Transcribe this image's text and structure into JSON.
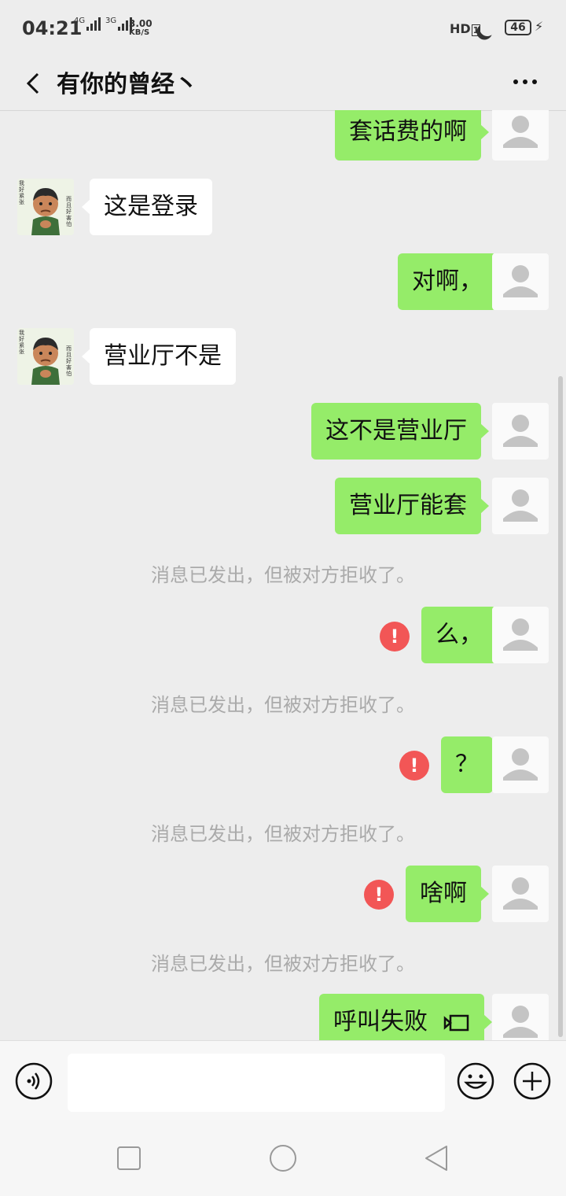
{
  "status_bar": {
    "time": "04:21",
    "net1": "4G",
    "net2": "3G",
    "speed_value": "3.00",
    "speed_unit": "KB/S",
    "hd_label": "HD",
    "hd_sub": "1",
    "battery": "46"
  },
  "header": {
    "title": "有你的曾经丶",
    "back_icon": "chevron-left-icon",
    "more_icon": "more-dots-icon"
  },
  "messages": [
    {
      "side": "out",
      "text": "套话费的啊"
    },
    {
      "side": "in",
      "text": "这是登录"
    },
    {
      "side": "out",
      "text": "对啊，"
    },
    {
      "side": "in",
      "text": "营业厅不是"
    },
    {
      "side": "out",
      "text": "这不是营业厅"
    },
    {
      "side": "out",
      "text": "营业厅能套"
    },
    {
      "side": "system",
      "text": "消息已发出，但被对方拒收了。"
    },
    {
      "side": "out",
      "text": "么，",
      "failed": true,
      "fail_mark": "!"
    },
    {
      "side": "system",
      "text": "消息已发出，但被对方拒收了。"
    },
    {
      "side": "out",
      "text": "？",
      "failed": true,
      "fail_mark": "!"
    },
    {
      "side": "system",
      "text": "消息已发出，但被对方拒收了。"
    },
    {
      "side": "out",
      "text": "啥啊",
      "failed": true,
      "fail_mark": "!"
    },
    {
      "side": "system",
      "text": "消息已发出，但被对方拒收了。"
    },
    {
      "side": "out",
      "text": "呼叫失败",
      "icon": "video-call-icon"
    }
  ],
  "peer_avatar_caption_left": "我好紧张",
  "peer_avatar_caption_right": "而且好害怕",
  "input_bar": {
    "voice_icon": "voice-icon",
    "emoji_icon": "emoji-icon",
    "plus_icon": "plus-icon",
    "placeholder": ""
  },
  "nav_bar": {
    "recent_icon": "square-icon",
    "home_icon": "circle-icon",
    "back_icon": "triangle-back-icon"
  },
  "colors": {
    "background": "#ededed",
    "bubble_out": "#95ec69",
    "bubble_in": "#ffffff",
    "error": "#f25656",
    "system_text": "#aaaaaa"
  }
}
